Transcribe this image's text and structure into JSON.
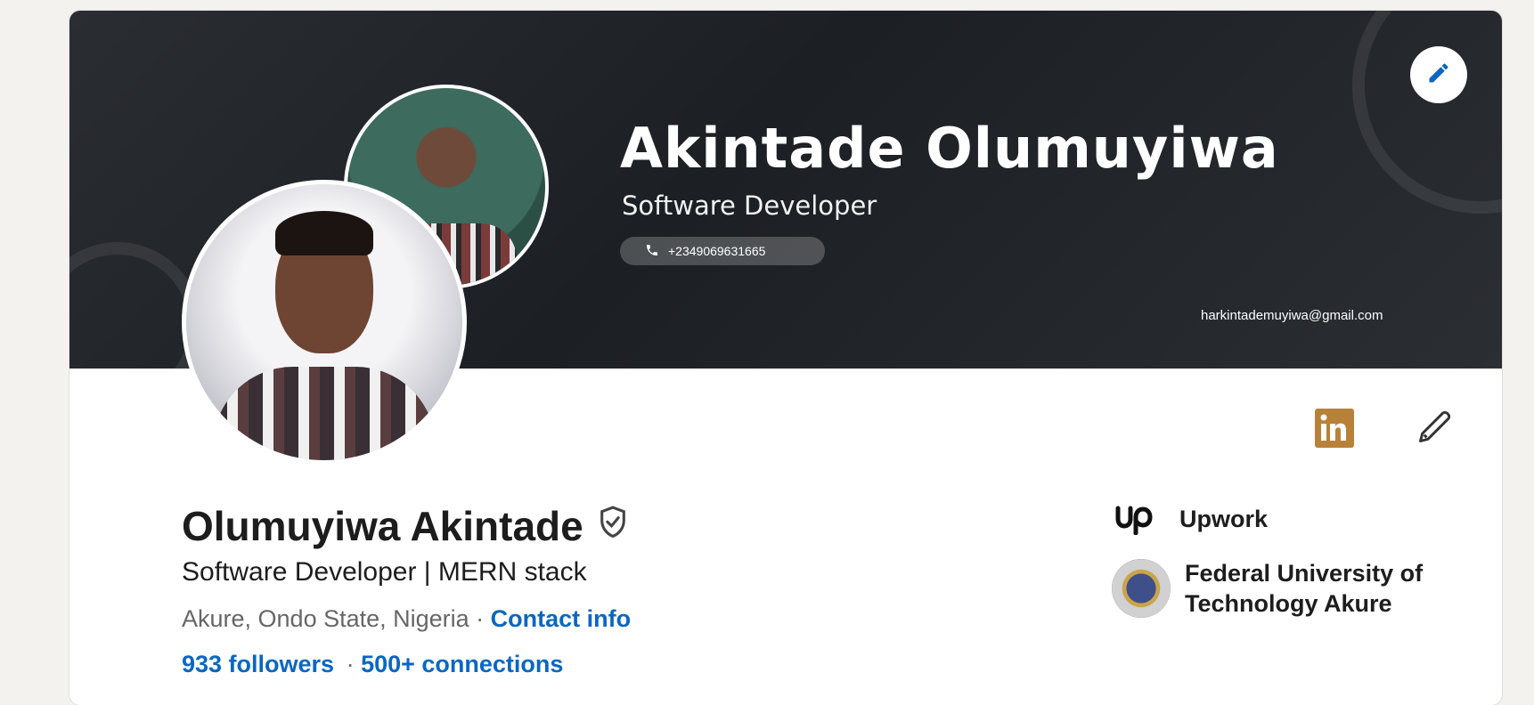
{
  "banner": {
    "name": "Akintade Olumuyiwa",
    "role": "Software Developer",
    "phone": "+2349069631665",
    "email": "harkintademuyiwa@gmail.com"
  },
  "profile": {
    "name": "Olumuyiwa Akintade",
    "headline": "Software Developer | MERN stack",
    "location": "Akure, Ondo State, Nigeria",
    "separator": " · ",
    "contact_info": "Contact info",
    "followers": "933 followers",
    "connections": "500+ connections"
  },
  "organizations": [
    {
      "name": "Upwork",
      "logo": "upwork-logo"
    },
    {
      "name": "Federal University of Technology Akure",
      "logo": "futa-logo"
    }
  ],
  "colors": {
    "link": "#0a66c2",
    "linkedin_badge": "#b8813a",
    "text": "#1d1d1d",
    "muted": "#666666"
  },
  "icons": [
    "pencil-icon",
    "verified-shield-icon",
    "linkedin-badge-icon",
    "phone-icon"
  ]
}
